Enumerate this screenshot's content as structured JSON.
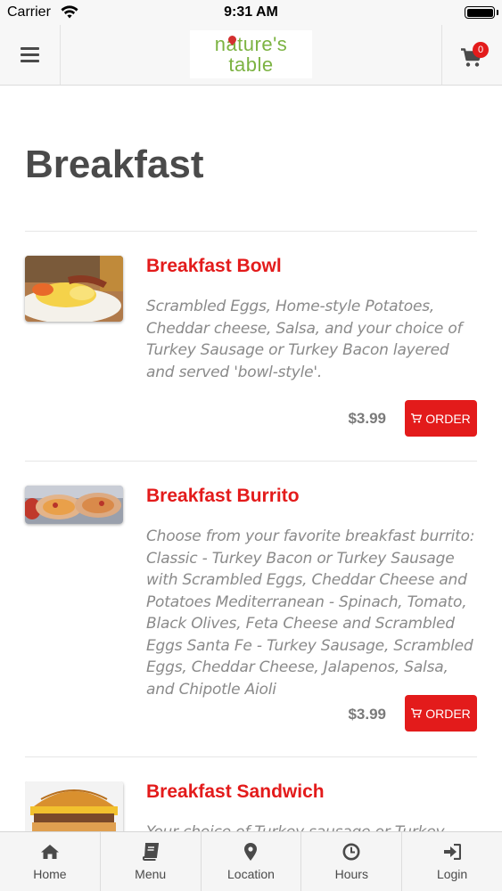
{
  "status_bar": {
    "carrier": "Carrier",
    "time": "9:31 AM"
  },
  "header": {
    "logo_line1": "nature's",
    "logo_line2": "table",
    "cart_count": "0"
  },
  "page": {
    "title": "Breakfast"
  },
  "items": [
    {
      "name": "Breakfast Bowl",
      "description": "Scrambled Eggs, Home-style Potatoes, Cheddar cheese, Salsa, and your choice of Turkey Sausage or Turkey Bacon layered and served 'bowl-style'.",
      "price": "$3.99",
      "order_label": "ORDER"
    },
    {
      "name": "Breakfast Burrito",
      "description": "Choose from your favorite breakfast burrito: Classic - Turkey Bacon or Turkey Sausage with Scrambled Eggs, Cheddar Cheese and Potatoes Mediterranean - Spinach, Tomato, Black Olives, Feta Cheese and Scrambled Eggs Santa Fe - Turkey Sausage, Scrambled Eggs, Cheddar Cheese, Jalapenos, Salsa, and Chipotle Aioli",
      "price": "$3.99",
      "order_label": "ORDER"
    },
    {
      "name": "Breakfast Sandwich",
      "description": "Your choice of Turkey sausage or Turkey bacon"
    }
  ],
  "tabs": [
    {
      "label": "Home",
      "icon": "home-icon"
    },
    {
      "label": "Menu",
      "icon": "book-icon"
    },
    {
      "label": "Location",
      "icon": "map-pin-icon"
    },
    {
      "label": "Hours",
      "icon": "clock-icon"
    },
    {
      "label": "Login",
      "icon": "login-icon"
    }
  ],
  "colors": {
    "accent": "#e31b1b",
    "brand_green": "#7cb342",
    "text": "#4a4a4a",
    "muted": "#8a8a8a"
  }
}
